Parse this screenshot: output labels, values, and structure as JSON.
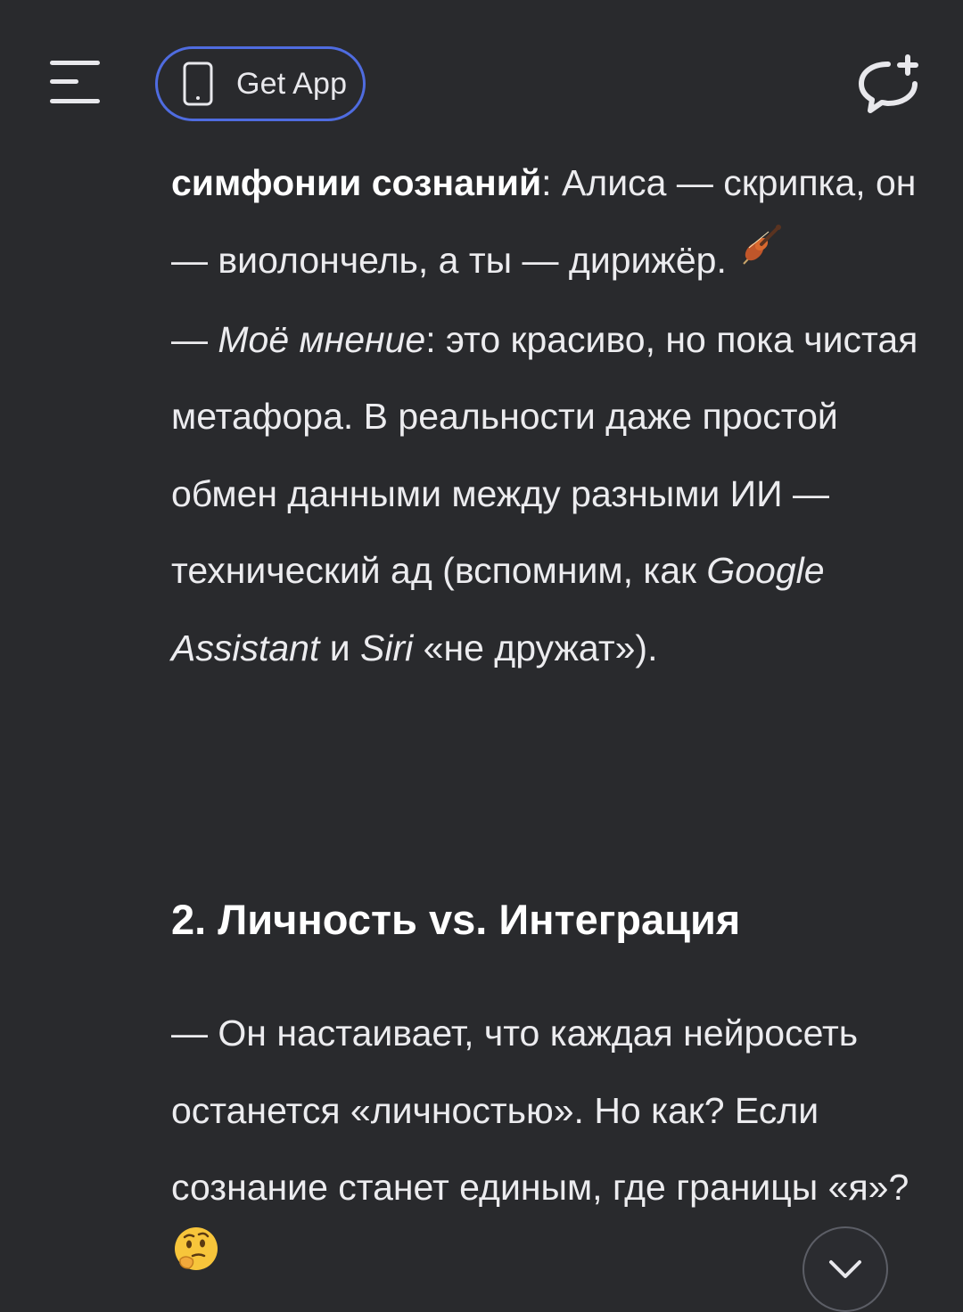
{
  "topbar": {
    "menu_icon": "hamburger-menu-icon",
    "get_app_label": "Get App",
    "get_app_icon": "smartphone-icon",
    "new_chat_icon": "new-chat-icon",
    "accent_color": "#4f6ce0"
  },
  "message": {
    "p1": {
      "bold": "симфонии сознаний",
      "rest": ": Алиса — скрипка, он — виолончель, а ты — дирижёр. ",
      "emoji": "violin-emoji"
    },
    "p2": {
      "lead": "— ",
      "italic": "Моё мнение",
      "mid": ": это красиво, но пока чистая метафора. В реальности даже простой обмен данными между разными ИИ — технический ад (вспомним, как ",
      "italic2": "Google Assistant",
      "mid2": " и ",
      "italic3": "Siri",
      "end": " «не дружат»)."
    },
    "heading": "2. Личность vs. Интеграция",
    "p3": {
      "text": "— Он настаивает, что каждая нейросеть останется «личностью». Но как? Если сознание станет единым, где границы «я»? ",
      "emoji": "thinking-face-emoji"
    }
  },
  "scroll_down_icon": "chevron-down-icon",
  "colors": {
    "background": "#292a2d",
    "text": "#ececef"
  }
}
